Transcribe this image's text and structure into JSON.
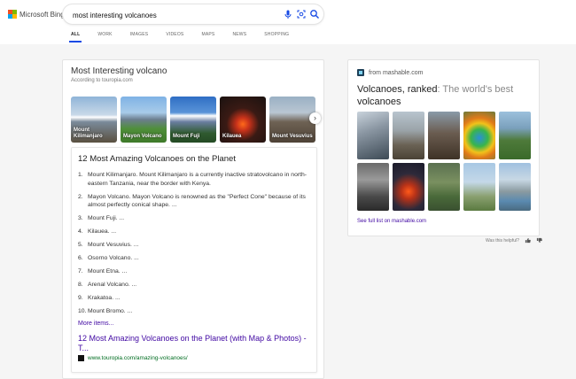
{
  "brand": {
    "name": "Microsoft Bing"
  },
  "search": {
    "query": "most interesting volcanoes"
  },
  "tabs": [
    {
      "label": "ALL",
      "active": true
    },
    {
      "label": "WORK"
    },
    {
      "label": "IMAGES"
    },
    {
      "label": "VIDEOS"
    },
    {
      "label": "MAPS"
    },
    {
      "label": "NEWS"
    },
    {
      "label": "SHOPPING"
    }
  ],
  "answer": {
    "title": "Most Interesting volcano",
    "source": "According to touropia.com",
    "carousel": [
      "Mount Kilimanjaro",
      "Mayon Volcano",
      "Mount Fuji",
      "Kilauea",
      "Mount Vesuvius"
    ],
    "article": {
      "title": "12 Most Amazing Volcanoes on the Planet",
      "items": [
        {
          "num": "1.",
          "text": "Mount Kilimanjaro. Mount Kilimanjaro is a currently inactive stratovolcano in north-eastern Tanzania, near the border with Kenya."
        },
        {
          "num": "2.",
          "text": "Mayon Volcano. Mayon Volcano is renowned as the \"Perfect Cone\" because of its almost perfectly conical shape. ..."
        },
        {
          "num": "3.",
          "text": "Mount Fuji. ..."
        },
        {
          "num": "4.",
          "text": "Kilauea. ..."
        },
        {
          "num": "5.",
          "text": "Mount Vesuvius. ..."
        },
        {
          "num": "6.",
          "text": "Osorno Volcano. ..."
        },
        {
          "num": "7.",
          "text": "Mount Etna. ..."
        },
        {
          "num": "8.",
          "text": "Arenal Volcano. ..."
        },
        {
          "num": "9.",
          "text": "Krakatoa. ..."
        },
        {
          "num": "10.",
          "text": "Mount Bromo. ..."
        }
      ],
      "more": "More items...",
      "link": "12 Most Amazing Volcanoes on the Planet (with Map & Photos) - T...",
      "url": "www.touropia.com/amazing-volcanoes/"
    }
  },
  "side": {
    "source": "from mashable.com",
    "headline_main": "Volcanoes, ranked",
    "headline_sep": ":",
    "headline_muted": " The world's best",
    "headline_end": "volcanoes",
    "see_full": "See full list on mashable.com",
    "helpful": "Was this helpful?"
  }
}
